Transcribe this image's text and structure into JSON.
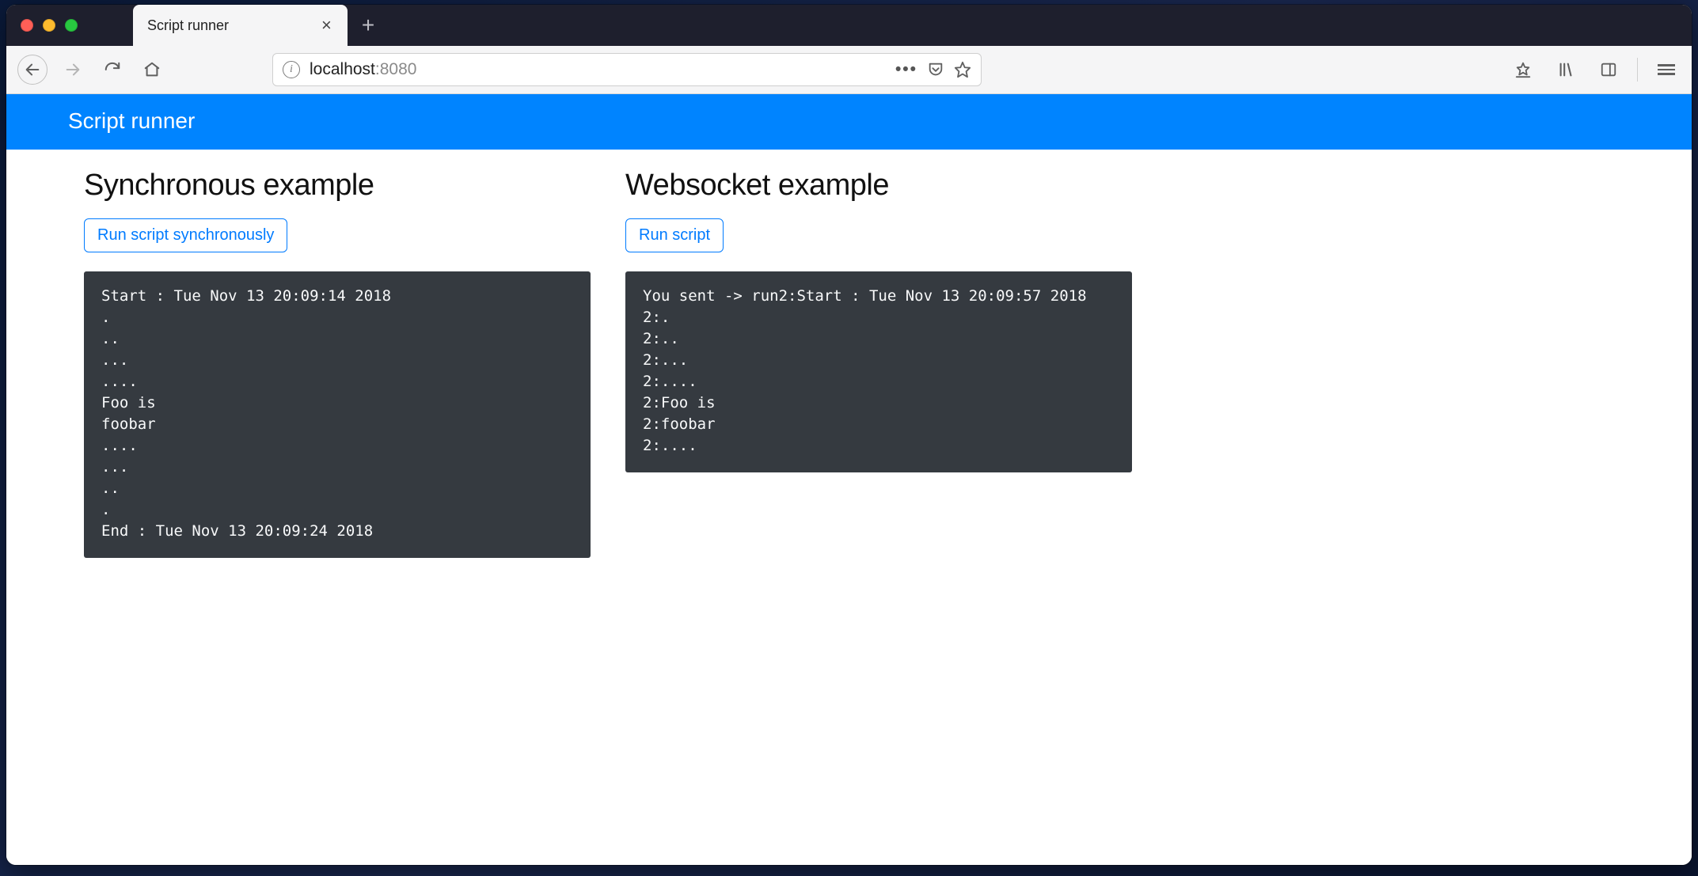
{
  "browser": {
    "tab_title": "Script runner",
    "url_host": "localhost",
    "url_port": ":8080"
  },
  "page": {
    "banner_title": "Script runner",
    "sync": {
      "heading": "Synchronous example",
      "button_label": "Run script synchronously",
      "output_lines": [
        "Start : Tue Nov 13 20:09:14 2018",
        ".",
        "..",
        "...",
        "....",
        "Foo is",
        "foobar",
        "....",
        "...",
        "..",
        ".",
        "End : Tue Nov 13 20:09:24 2018"
      ]
    },
    "ws": {
      "heading": "Websocket example",
      "button_label": "Run script",
      "output_lines": [
        "You sent -> run2:Start : Tue Nov 13 20:09:57 2018",
        "2:.",
        "2:..",
        "2:...",
        "2:....",
        "2:Foo is",
        "2:foobar",
        "2:...."
      ]
    }
  }
}
